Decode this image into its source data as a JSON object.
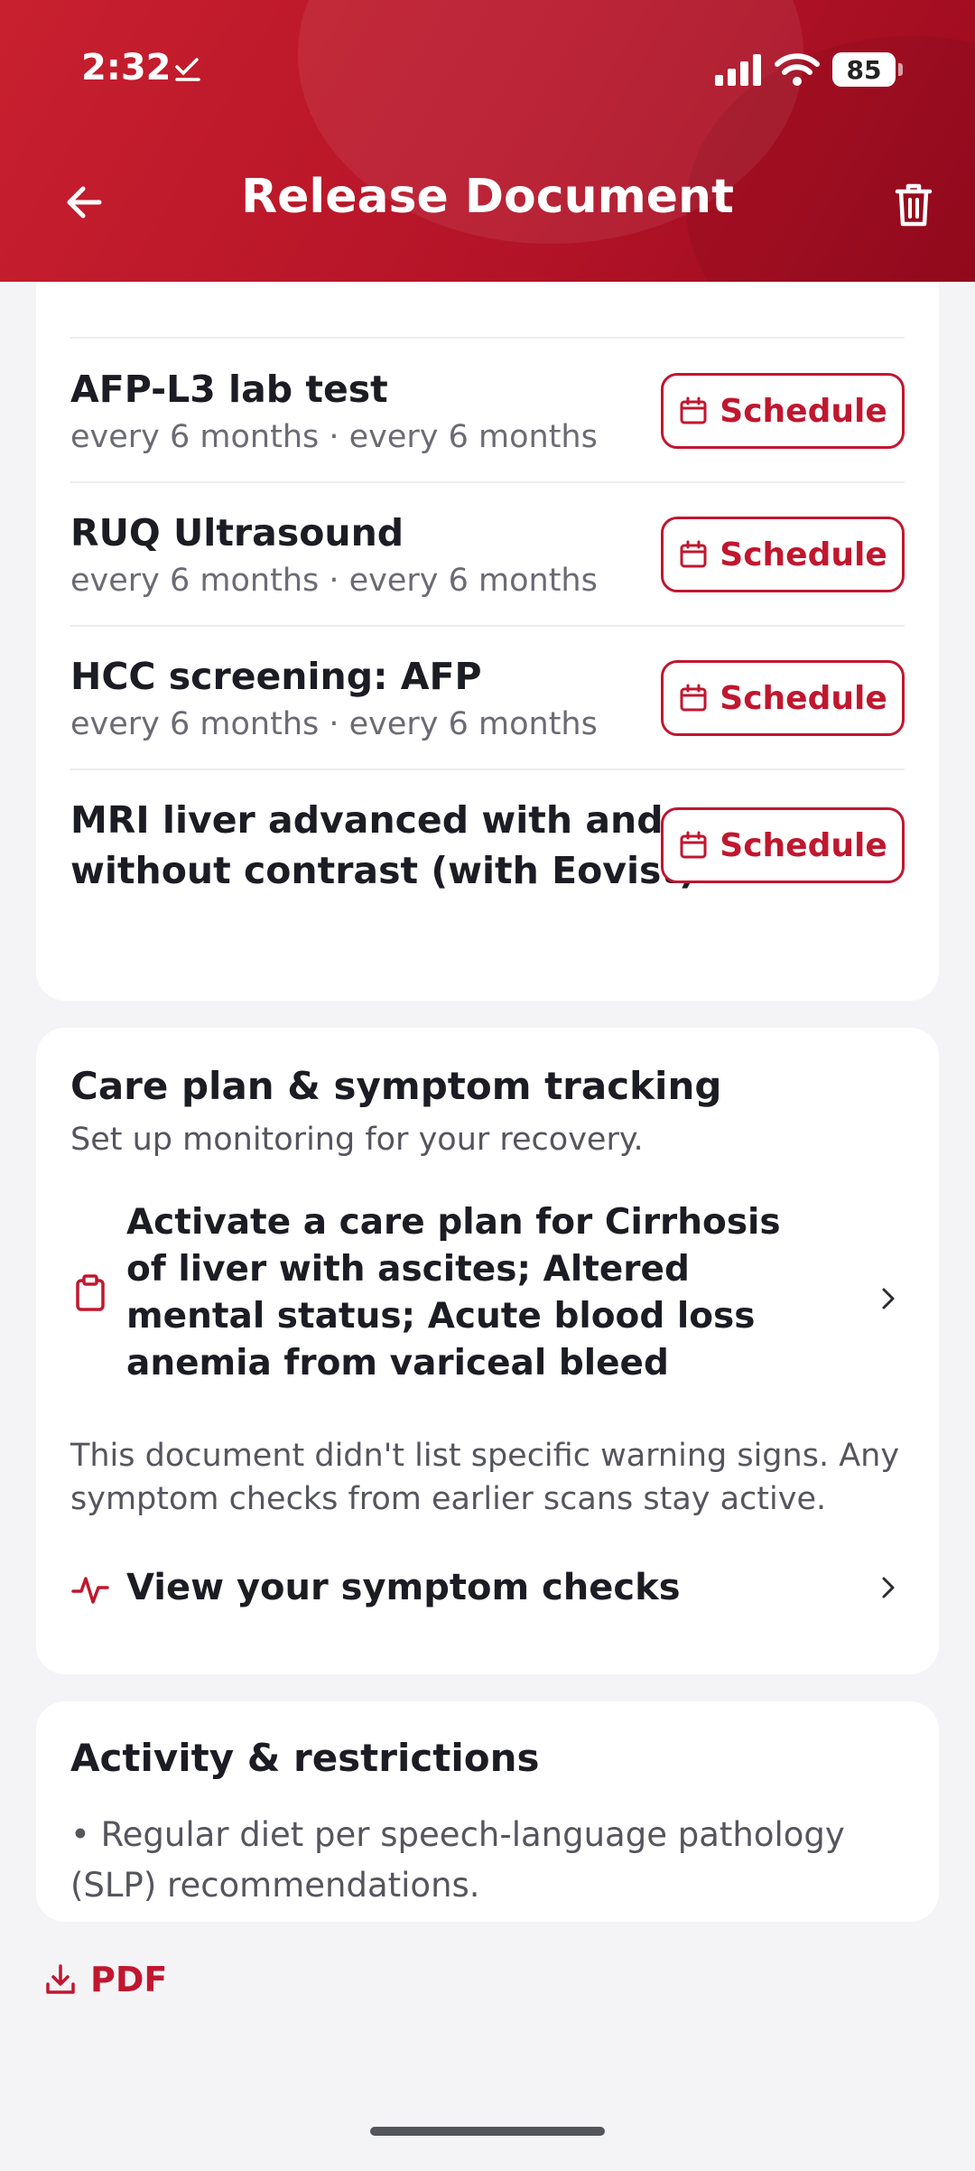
{
  "status_bar": {
    "time": "2:32",
    "battery": "85"
  },
  "nav": {
    "title": "Release Document",
    "back_icon": "arrow-left-icon",
    "delete_icon": "trash-icon"
  },
  "followups": {
    "items": [
      {
        "title": "AFP-L3 lab test",
        "subtitle": "every 6 months · every 6 months",
        "button": "Schedule"
      },
      {
        "title": "RUQ Ultrasound",
        "subtitle": "every 6 months · every 6 months",
        "button": "Schedule"
      },
      {
        "title": "HCC screening: AFP",
        "subtitle": "every 6 months · every 6 months",
        "button": "Schedule"
      },
      {
        "title_line1": "MRI liver advanced with and",
        "title_line2": "without contrast (with Eovist)",
        "button": "Schedule"
      }
    ]
  },
  "care_plan": {
    "title": "Care plan & symptom tracking",
    "subtitle": "Set up monitoring for your recovery.",
    "activate_text": "Activate a care plan for Cirrhosis of liver with ascites; Altered mental status; Acute blood loss anemia from variceal bleed",
    "note": "This document didn't list specific warning signs. Any symptom checks from earlier scans stay active.",
    "view_checks": "View your symptom checks"
  },
  "activity": {
    "title": "Activity & restrictions",
    "text": "• Regular diet per speech-language pathology (SLP) recommendations."
  },
  "pdf_label": "PDF",
  "colors": {
    "accent": "#c0172f",
    "header": "#b51428",
    "background": "#f4f4f7"
  }
}
